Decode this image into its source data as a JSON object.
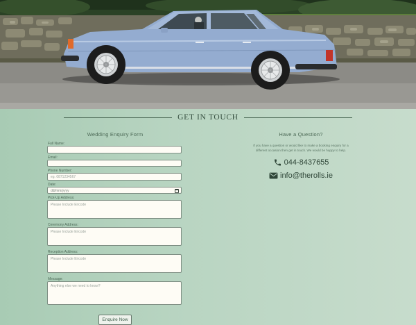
{
  "hero": {
    "image_alt": "Light blue vintage Rolls-Royce parked beside a stone wall"
  },
  "section": {
    "title": "GET IN TOUCH"
  },
  "form": {
    "heading": "Wedding Enquiry Form",
    "fields": {
      "full_name": {
        "label": "Full Name:",
        "placeholder": ""
      },
      "email": {
        "label": "Email:",
        "placeholder": ""
      },
      "phone": {
        "label": "Phone Number:",
        "placeholder": "eg. 0871234567"
      },
      "date": {
        "label": "Date:",
        "placeholder": "dd/mm/yyyy"
      },
      "pickup": {
        "label": "Pick-Up Address:",
        "placeholder": "Please Include Eircode"
      },
      "ceremony": {
        "label": "Ceremony Address:",
        "placeholder": "Please Include Eircode"
      },
      "reception": {
        "label": "Reception Address:",
        "placeholder": "Please Include Eircode"
      },
      "message": {
        "label": "Message:",
        "placeholder": "Anything else we need to know?"
      }
    },
    "submit_label": "Enquire Now"
  },
  "info": {
    "heading": "Have a Question?",
    "text": "If you have a question or would like to make a booking enquiry for a different occasion then get in touch. We would be happy to help.",
    "phone": "044-8437655",
    "email": "info@therolls.ie",
    "phone_icon": "phone-icon",
    "email_icon": "envelope-icon"
  },
  "colors": {
    "background": "#b7d3c1",
    "heading": "#354e3f",
    "input_bg": "#fefcf5"
  }
}
